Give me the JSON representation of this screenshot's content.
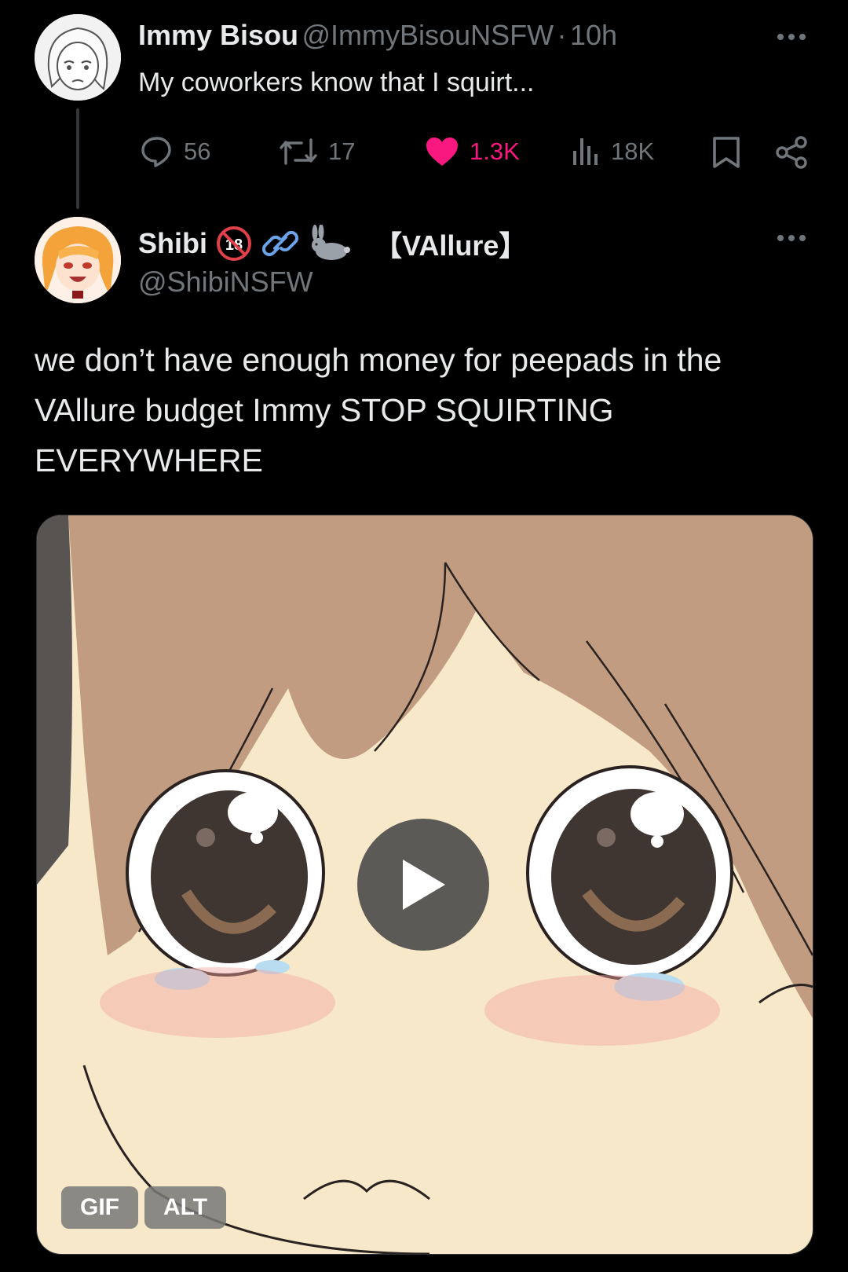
{
  "parent_tweet": {
    "author_name": "Immy Bisou",
    "author_handle": "@ImmyBisouNSFW",
    "separator": "·",
    "time": "10h",
    "text": "My coworkers know that I squirt...",
    "more_icon": "more-horizontal-icon",
    "actions": {
      "replies": "56",
      "retweets": "17",
      "likes": "1.3K",
      "views": "18K"
    },
    "colors": {
      "like": "#f91880",
      "muted": "#71767b"
    }
  },
  "reply_tweet": {
    "author_name": "Shibi",
    "badges": [
      "no-18-icon",
      "link-icon",
      "rabbit-icon"
    ],
    "affiliation": "【VAllure】",
    "author_handle": "@ShibiNSFW",
    "text": "we don’t have enough money for peepads in the VAllure budget Immy STOP SQUIRTING EVERYWHERE",
    "media": {
      "type": "gif",
      "gif_label": "GIF",
      "alt_label": "ALT",
      "play_icon": "play-icon"
    }
  }
}
